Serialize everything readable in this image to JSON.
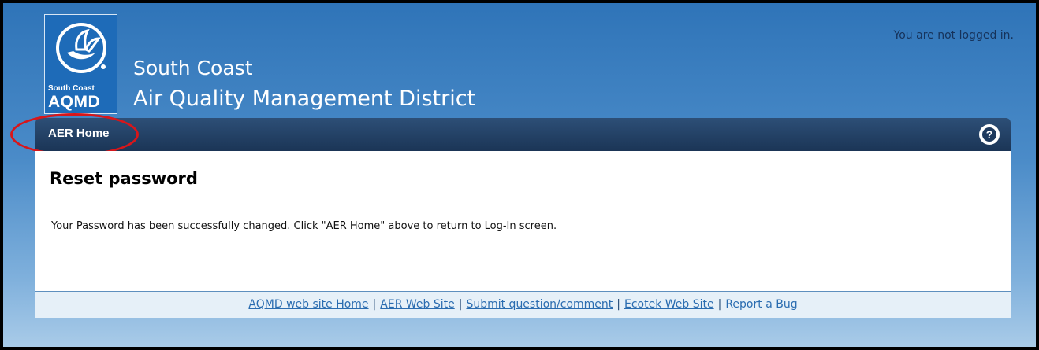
{
  "header": {
    "logo": {
      "small_text": "South Coast",
      "big_text": "AQMD"
    },
    "org_name_line1": "South Coast",
    "org_name_line2": "Air Quality Management District",
    "login_status": "You are not logged in."
  },
  "nav": {
    "home_label": "AER Home",
    "help_icon": "help-circle-icon",
    "highlight_color": "#d8161a"
  },
  "main": {
    "title": "Reset password",
    "message": "Your Password has been successfully changed. Click \"AER Home\" above to return to Log-In screen."
  },
  "footer": {
    "links": [
      "AQMD web site Home",
      "AER Web Site",
      "Submit question/comment",
      "Ecotek Web Site",
      "Report a Bug"
    ],
    "separator": "|"
  },
  "colors": {
    "nav_bar": "#1b3556",
    "brand_blue": "#1e6bb8",
    "link": "#2a6cb0"
  }
}
